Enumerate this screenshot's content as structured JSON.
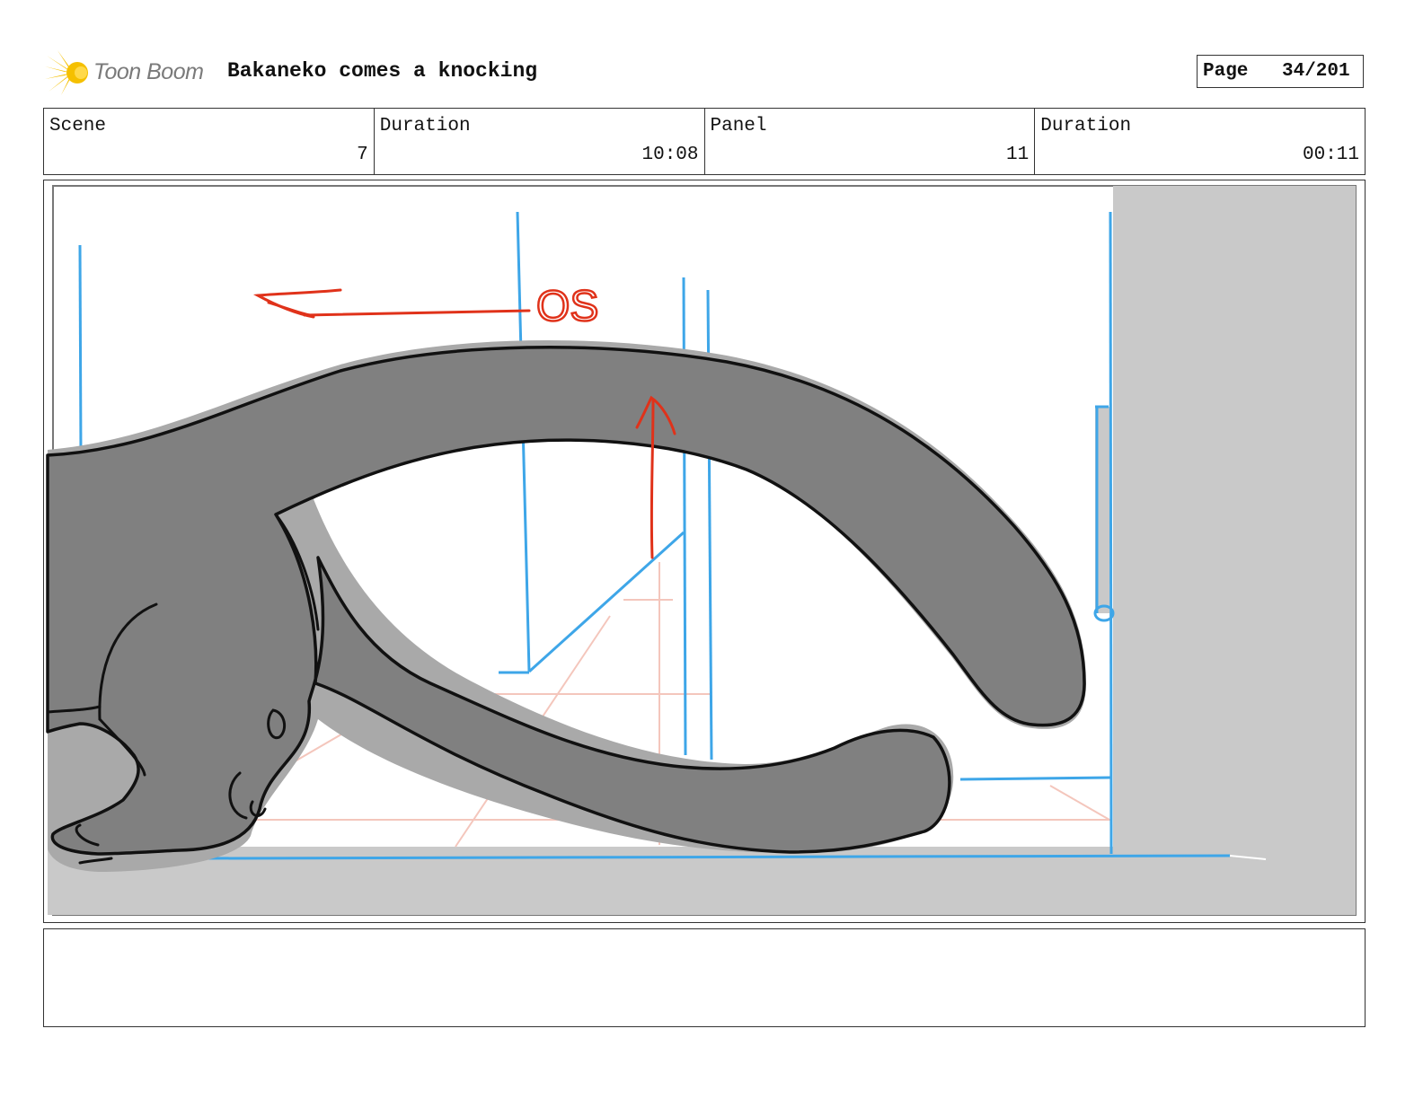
{
  "header": {
    "logo_text": "Toon Boom",
    "project_title": "Bakaneko comes a knocking",
    "page_label": "Page",
    "page_value": "34/201"
  },
  "info": {
    "scene_label": "Scene",
    "scene_value": "7",
    "scene_duration_label": "Duration",
    "scene_duration_value": "10:08",
    "panel_label": "Panel",
    "panel_value": "11",
    "panel_duration_label": "Duration",
    "panel_duration_value": "00:11"
  },
  "panel_art": {
    "annotation_text": "OS"
  },
  "colors": {
    "accent_logo": "#f5c000",
    "layout_lines": "#3ea6e8",
    "annotation": "#e0321a",
    "cat_fill": "#808080",
    "shadow": "#c9c9c9"
  },
  "notes": {
    "text": ""
  }
}
